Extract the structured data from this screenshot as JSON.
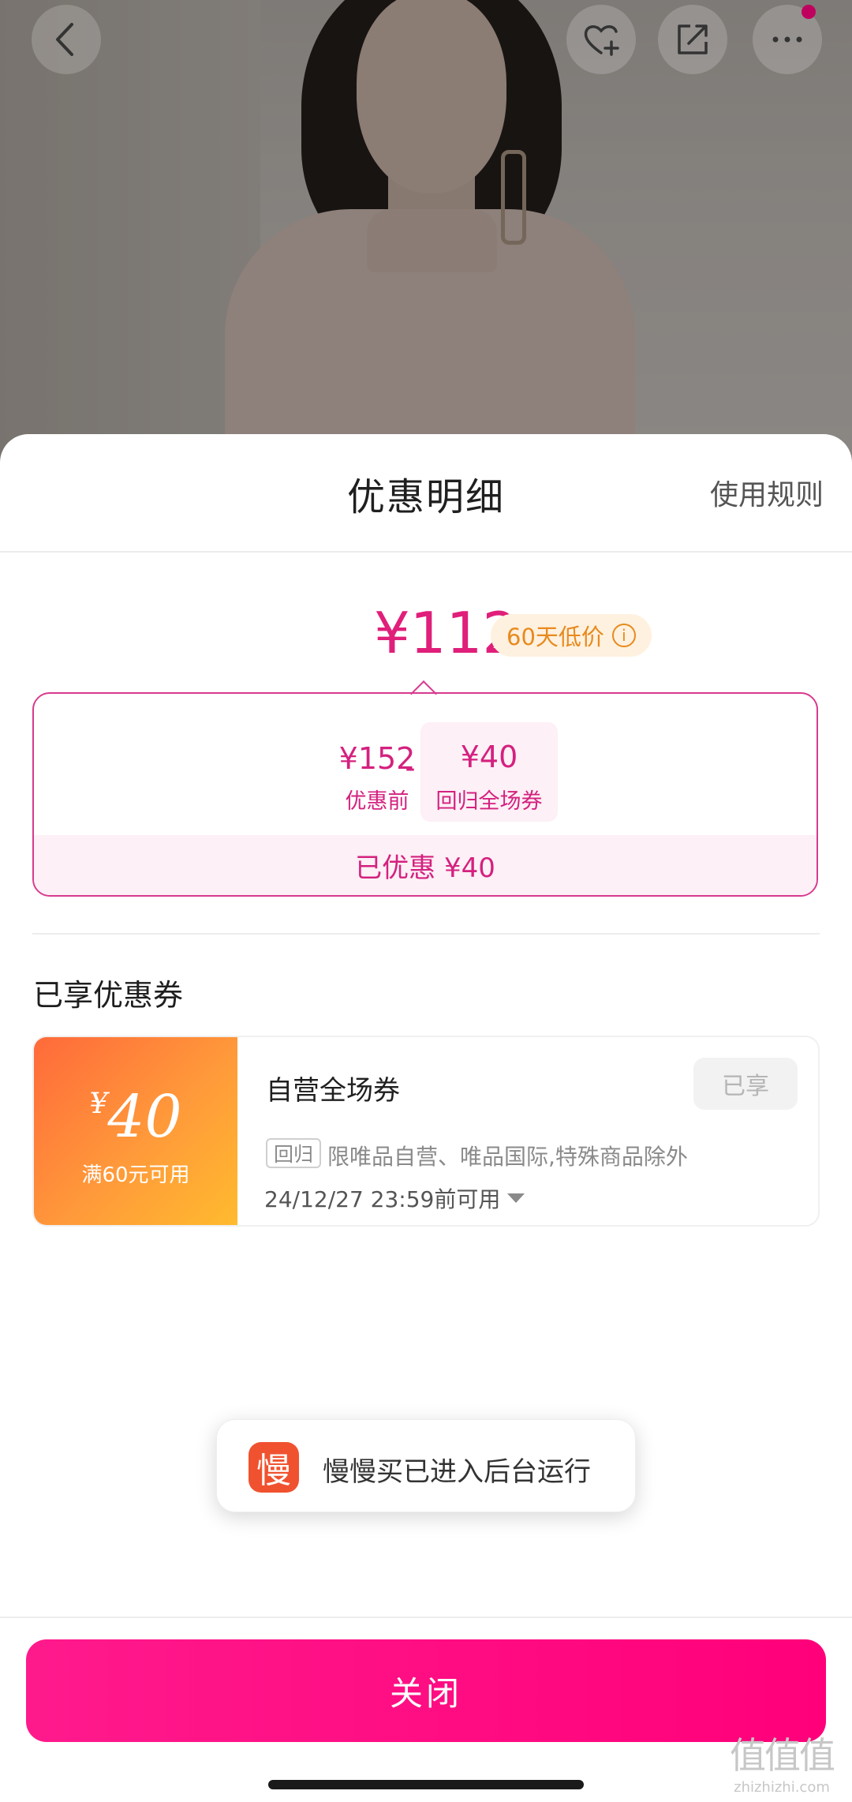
{
  "header": {
    "back_icon": "chevron-left-icon",
    "favorite_icon": "heart-plus-icon",
    "share_icon": "share-icon",
    "more_icon": "more-dots-icon"
  },
  "sheet": {
    "title": "优惠明细",
    "rules_link": "使用规则"
  },
  "price": {
    "final": "¥112",
    "low_badge": "60天低价",
    "info_icon": "i"
  },
  "breakdown": {
    "original_amount": "¥152",
    "original_label": "优惠前",
    "operator": "-",
    "discount_amount": "¥40",
    "discount_label": "回归全场券",
    "saved_text": "已优惠 ¥40"
  },
  "coupons_section": {
    "title": "已享优惠券",
    "items": [
      {
        "currency": "¥",
        "amount": "40",
        "condition": "满60元可用",
        "name": "自营全场券",
        "status": "已享",
        "tag": "回归",
        "scope": "限唯品自营、唯品国际,特殊商品除外",
        "expiry": "24/12/27 23:59前可用"
      }
    ]
  },
  "toast": {
    "icon_char": "慢",
    "text": "慢慢买已进入后台运行"
  },
  "footer": {
    "close_label": "关闭"
  },
  "watermark": {
    "logo": "值值值",
    "url": "zhizhizhi.com"
  },
  "colors": {
    "accent": "#e01f7a",
    "button": "#ff1a8c",
    "badge_text": "#e88a1e",
    "coupon_gradient_start": "#ff6a3a",
    "coupon_gradient_end": "#ffbb2e"
  }
}
